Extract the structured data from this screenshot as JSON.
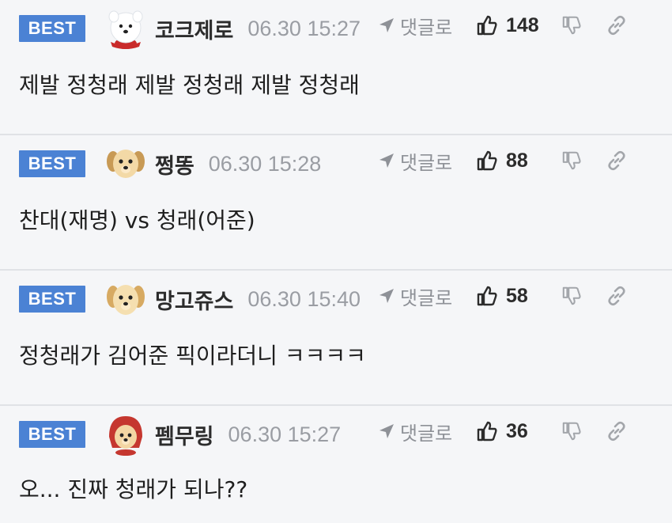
{
  "comments": [
    {
      "badge": "BEST",
      "nickname": "코크제로",
      "time": "06.30 15:27",
      "reply_label": "댓글로",
      "likes": "148",
      "body": "제발 정청래 제발 정청래 제발 정청래",
      "avatar": "white-dog"
    },
    {
      "badge": "BEST",
      "nickname": "쩡똥",
      "time": "06.30 15:28",
      "reply_label": "댓글로",
      "likes": "88",
      "body": "찬대(재명) vs 청래(어준)",
      "avatar": "golden-puppy"
    },
    {
      "badge": "BEST",
      "nickname": "망고쥬스",
      "time": "06.30 15:40",
      "reply_label": "댓글로",
      "likes": "58",
      "body": "정청래가 김어준 픽이라더니 ㅋㅋㅋㅋ",
      "avatar": "golden-puppy"
    },
    {
      "badge": "BEST",
      "nickname": "펨무링",
      "time": "06.30 15:27",
      "reply_label": "댓글로",
      "likes": "36",
      "body": "오... 진짜 청래가 되나??",
      "avatar": "hooded-puppy"
    }
  ],
  "colors": {
    "badge_bg": "#4b82d4",
    "background": "#f5f6f8",
    "divider": "#e0e2e6",
    "muted_text": "#9a9da3"
  }
}
